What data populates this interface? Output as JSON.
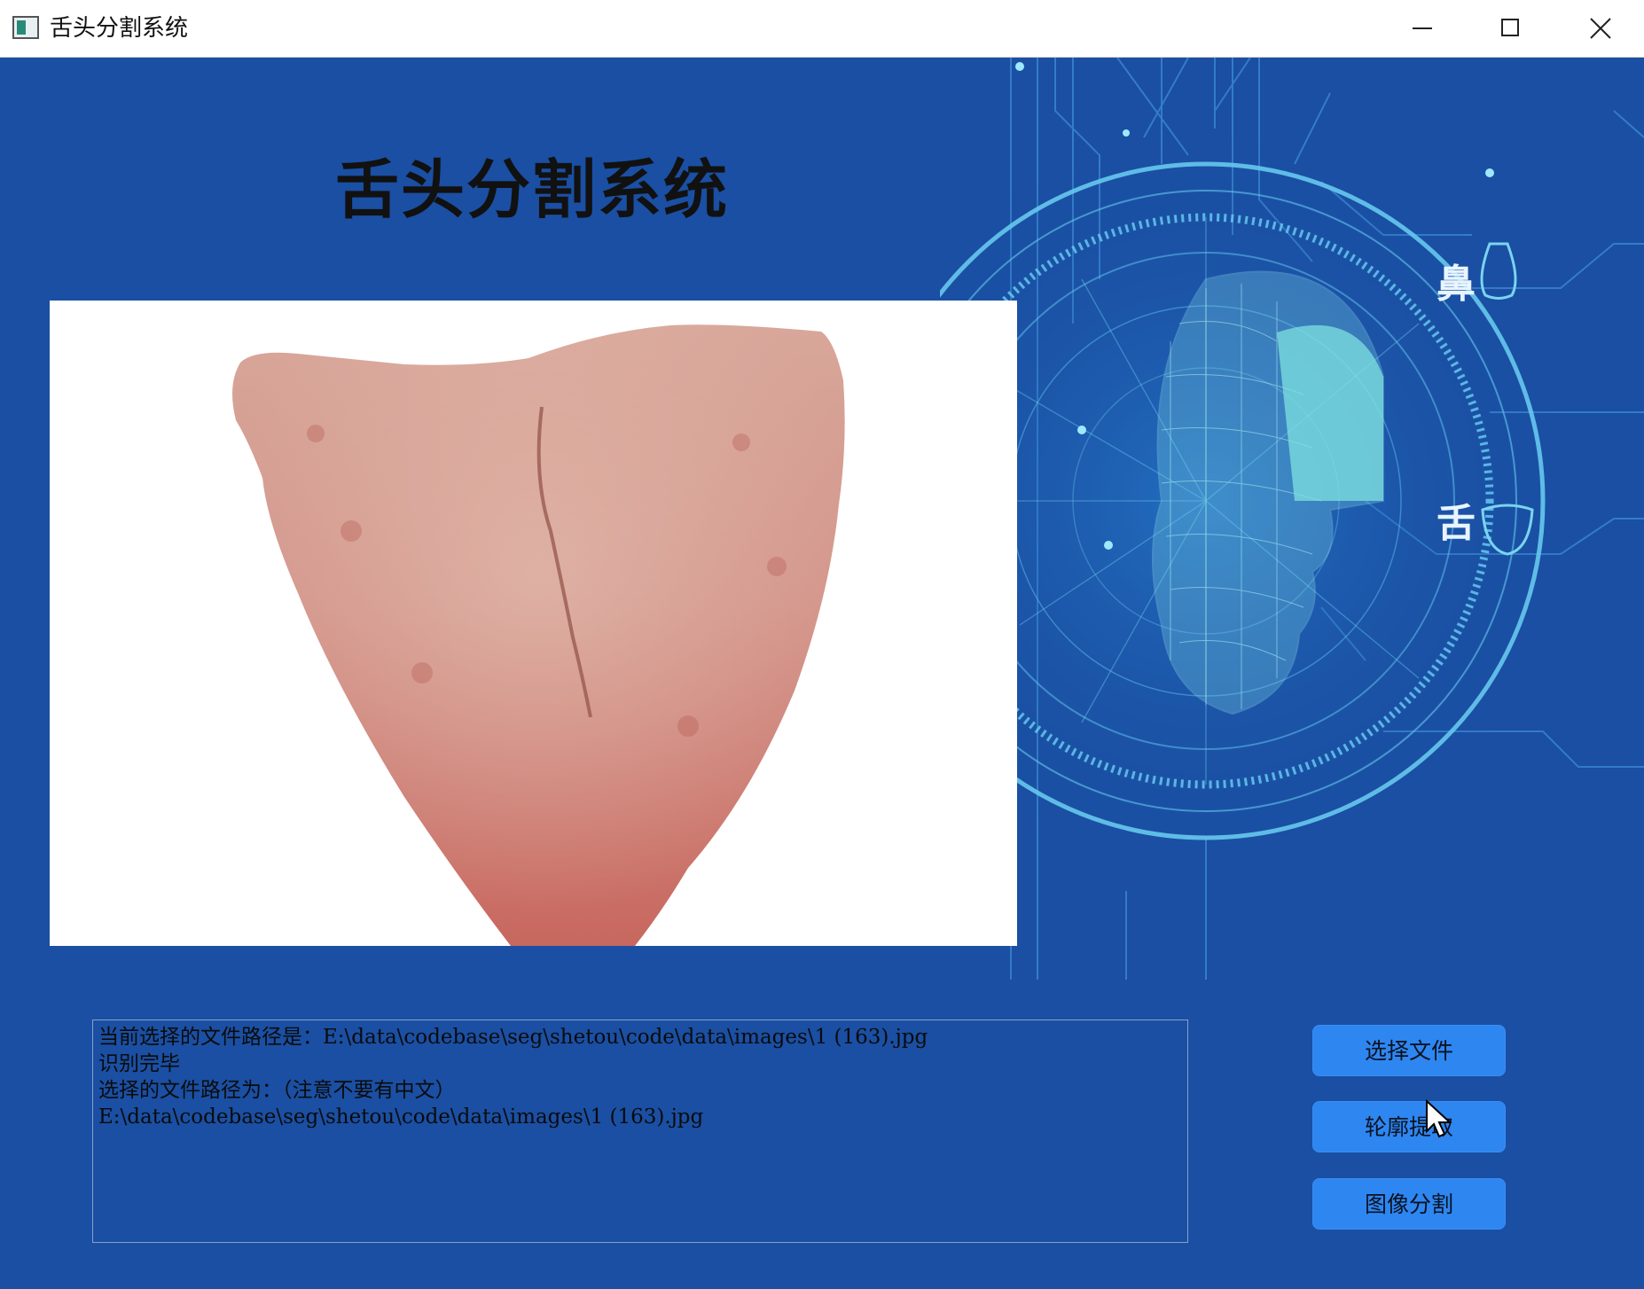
{
  "window": {
    "title": "舌头分割系统"
  },
  "header": {
    "title": "舌头分割系统"
  },
  "background": {
    "labels": [
      "鼻",
      "舌"
    ]
  },
  "log": {
    "lines": [
      "当前选择的文件路径是：E:\\data\\codebase\\seg\\shetou\\code\\data\\images\\1 (163).jpg",
      "识别完毕",
      "选择的文件路径为：（注意不要有中文）",
      "E:\\data\\codebase\\seg\\shetou\\code\\data\\images\\1 (163).jpg"
    ]
  },
  "buttons": {
    "select_file": "选择文件",
    "contour": "轮廓提取",
    "segment": "图像分割"
  },
  "colors": {
    "background": "#1a4fa3",
    "button": "#2e86f0",
    "accent": "#6ad0e8"
  }
}
